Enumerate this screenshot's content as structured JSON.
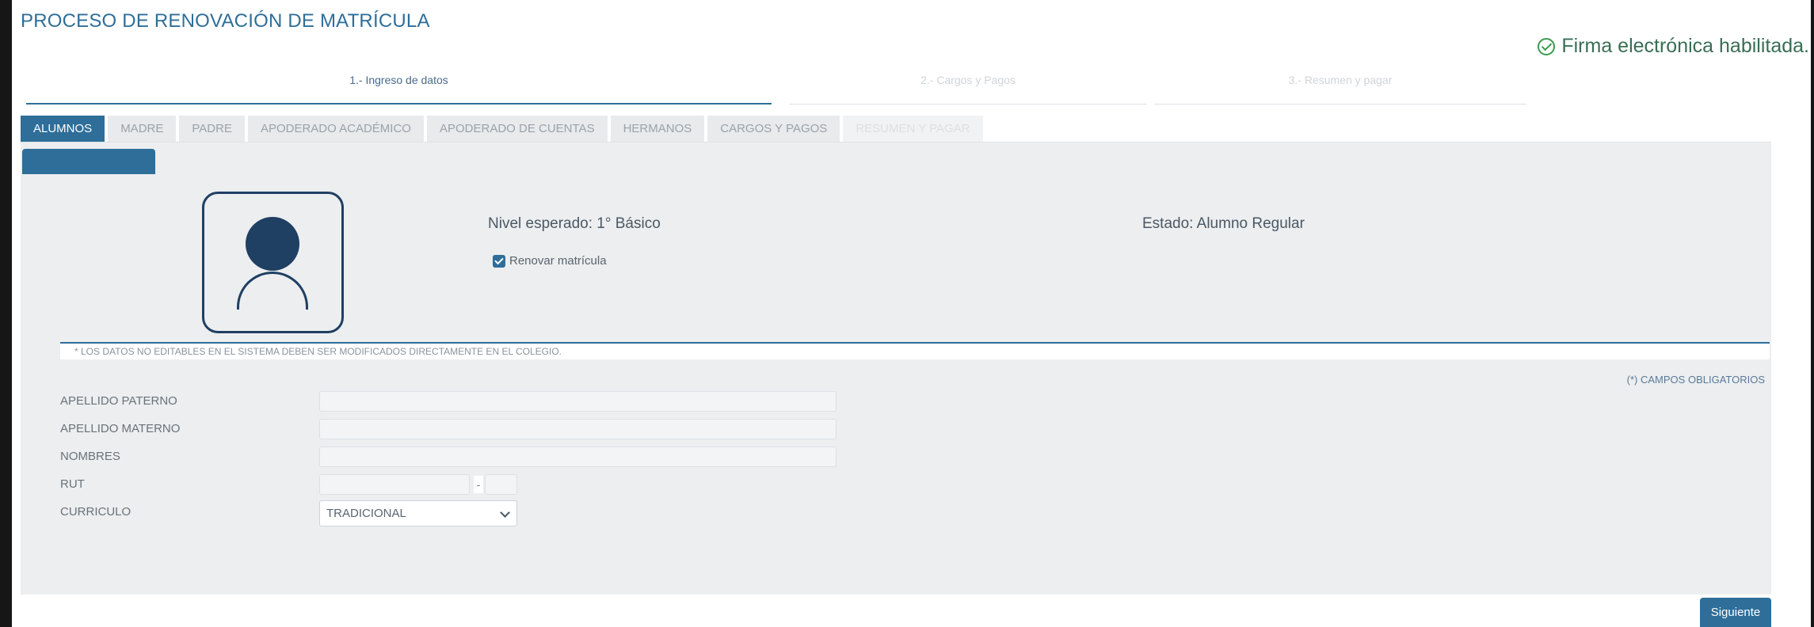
{
  "page_title": "PROCESO DE RENOVACIÓN DE MATRÍCULA",
  "firma": {
    "text": "Firma electrónica habilitada.",
    "icon": "check-circle-icon",
    "color": "#3a9a4e"
  },
  "steps": [
    {
      "label": "1.- Ingreso de datos",
      "state": "active"
    },
    {
      "label": "2.- Cargos y Pagos",
      "state": "inactive"
    },
    {
      "label": "3.- Resumen y pagar",
      "state": "inactive"
    }
  ],
  "tabs": [
    {
      "label": "ALUMNOS",
      "state": "active"
    },
    {
      "label": "MADRE",
      "state": "normal"
    },
    {
      "label": "PADRE",
      "state": "normal"
    },
    {
      "label": "APODERADO ACADÉMICO",
      "state": "normal"
    },
    {
      "label": "APODERADO DE CUENTAS",
      "state": "normal"
    },
    {
      "label": "HERMANOS",
      "state": "normal"
    },
    {
      "label": "CARGOS Y PAGOS",
      "state": "normal"
    },
    {
      "label": "RESUMEN Y PAGAR",
      "state": "disabled"
    }
  ],
  "student": {
    "nivel": "Nivel esperado: 1° Básico",
    "estado": "Estado: Alumno Regular",
    "renovar_label": "Renovar matrícula",
    "renovar_checked": true,
    "avatar_icon": "user-avatar-icon"
  },
  "note": "* LOS DATOS NO EDITABLES EN EL SISTEMA DEBEN SER MODIFICADOS DIRECTAMENTE EN EL COLEGIO.",
  "obligatorios": "(*) CAMPOS OBLIGATORIOS",
  "form": {
    "apellido_paterno": {
      "label": "APELLIDO PATERNO",
      "value": ""
    },
    "apellido_materno": {
      "label": "APELLIDO MATERNO",
      "value": ""
    },
    "nombres": {
      "label": "NOMBRES",
      "value": ""
    },
    "rut": {
      "label": "RUT",
      "value": "",
      "dv": "",
      "separator": "-"
    },
    "curriculo": {
      "label": "CURRICULO",
      "value": "TRADICIONAL"
    }
  },
  "buttons": {
    "siguiente": "Siguiente"
  },
  "colors": {
    "accent": "#2e6e99",
    "avatar": "#1f3f63",
    "panel_bg": "#eceeef"
  }
}
